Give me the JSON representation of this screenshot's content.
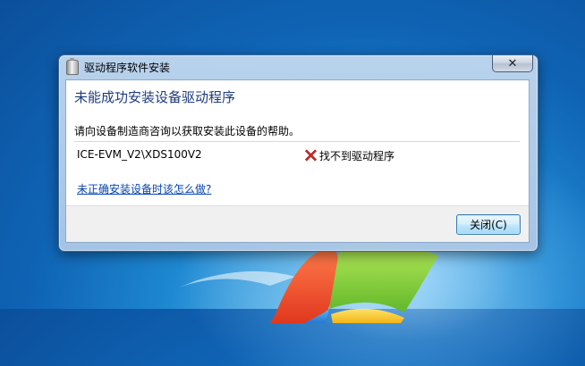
{
  "window": {
    "title": "驱动程序软件安装",
    "close_glyph": "✕"
  },
  "dialog": {
    "heading": "未能成功安装设备驱动程序",
    "description": "请向设备制造商咨询以获取安装此设备的帮助。",
    "device": {
      "name": "ICE-EVM_V2\\XDS100V2",
      "status_icon": "red-x-icon",
      "status": "找不到驱动程序"
    },
    "help_link": "未正确安装设备时该怎么做?",
    "close_button": "关闭(C)"
  },
  "colors": {
    "heading": "#1d3b7e",
    "link": "#0645ad",
    "error_icon": "#d42a2a"
  }
}
